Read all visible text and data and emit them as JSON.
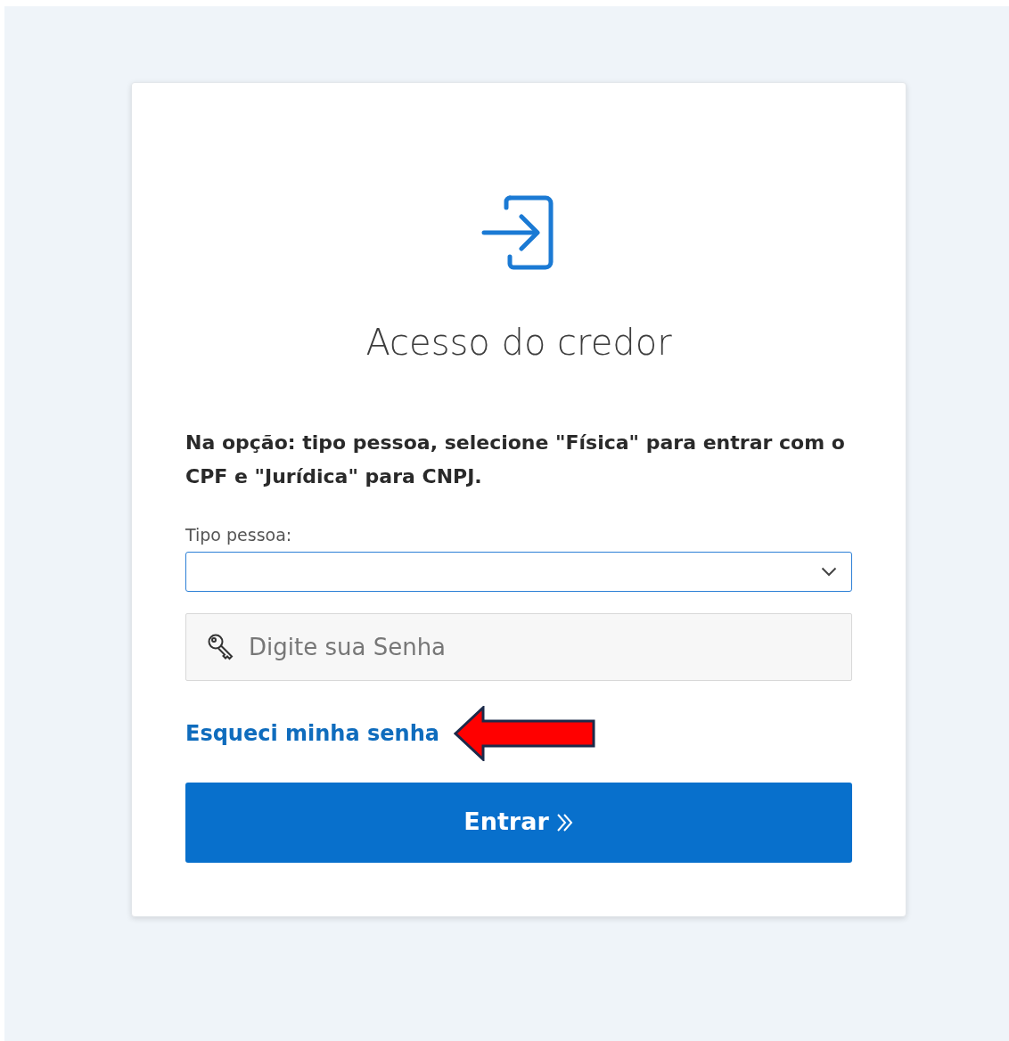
{
  "title": "Acesso do credor",
  "instruction": "Na opção: tipo pessoa, selecione \"Física\" para entrar com o CPF e \"Jurídica\" para CNPJ.",
  "person_type": {
    "label": "Tipo pessoa:"
  },
  "password": {
    "placeholder": "Digite sua Senha"
  },
  "forgot_link": "Esqueci minha senha",
  "submit_button": "Entrar"
}
